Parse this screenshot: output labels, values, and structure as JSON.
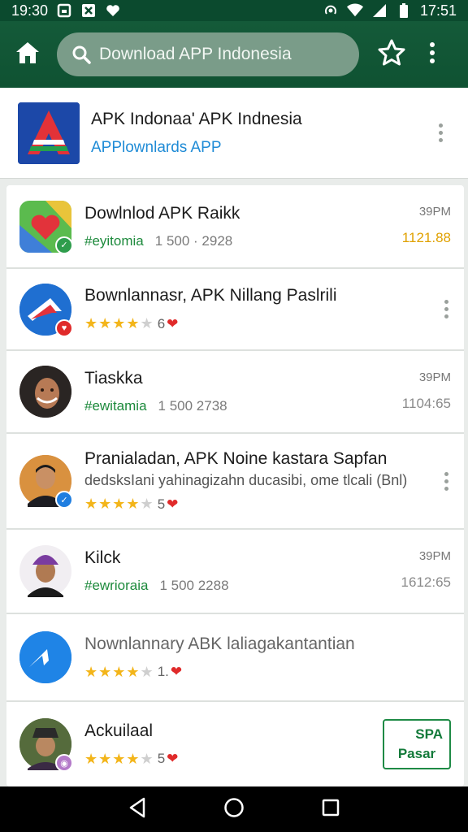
{
  "status_bar": {
    "time": "19:30",
    "clock": "17:51"
  },
  "app_bar": {
    "search_text": "Download APP Indonesia"
  },
  "featured": {
    "title": "APK Indonaa' APK Indnesia",
    "subtitle": "APPlownlards APP"
  },
  "list": [
    {
      "title": "Dowlnlod APK Raikk",
      "tag": "#eyitomia",
      "meta": "1 500 · 2928",
      "time": "39PM",
      "amount": "1121.88",
      "amount_color": "#e0a100",
      "avatar": "heart-app-icon",
      "badge_color": "#2e9d4c"
    },
    {
      "title": "Bownlannasr, APK Nillang Paslrili",
      "stars": "★★★★",
      "stars_dim": "★",
      "rating_count": "6",
      "avatar": "arrow-app-icon",
      "badge_color": "#e02a2a"
    },
    {
      "title": "Tiaskka",
      "tag": "#ewitamia",
      "meta": "1 500  2738",
      "time": "39PM",
      "amount": "1104:65",
      "amount_color": "#8a8a8a",
      "avatar": "woman-hijab-avatar"
    },
    {
      "title": "Pranialadan, APK Noine kastara Sapfan",
      "description": "dedsksIani yahinagizahn ducasibi, ome tlcali (Bnl)",
      "stars": "★★★★",
      "stars_dim": "★",
      "rating_count": "5",
      "avatar": "man-suit-avatar",
      "badge_color": "#1f7ee0"
    },
    {
      "title": "Kilck",
      "tag": "#ewrioraia",
      "meta": "1 500  2288",
      "time": "39PM",
      "amount": "1612:65",
      "amount_color": "#8a8a8a",
      "avatar": "man-purple-hat-avatar"
    },
    {
      "title": "Nownlannary ABK laliagakantantian",
      "stars": "★★★★",
      "stars_dim": "★",
      "rating_count": "1.",
      "avatar": "messenger-app-icon"
    },
    {
      "title": "Ackuilaal",
      "stars": "★★★★",
      "stars_dim": "★",
      "rating_count": "5",
      "avatar": "man-hat-avatar",
      "badge_color": "#b47ac9",
      "action_line1": "SPA",
      "action_line2": "Pasar"
    }
  ],
  "colors": {
    "brand_green": "#145a39",
    "tag_green": "#1d8a3c",
    "star_yellow": "#f3b51a",
    "heart_red": "#e02a2a"
  }
}
